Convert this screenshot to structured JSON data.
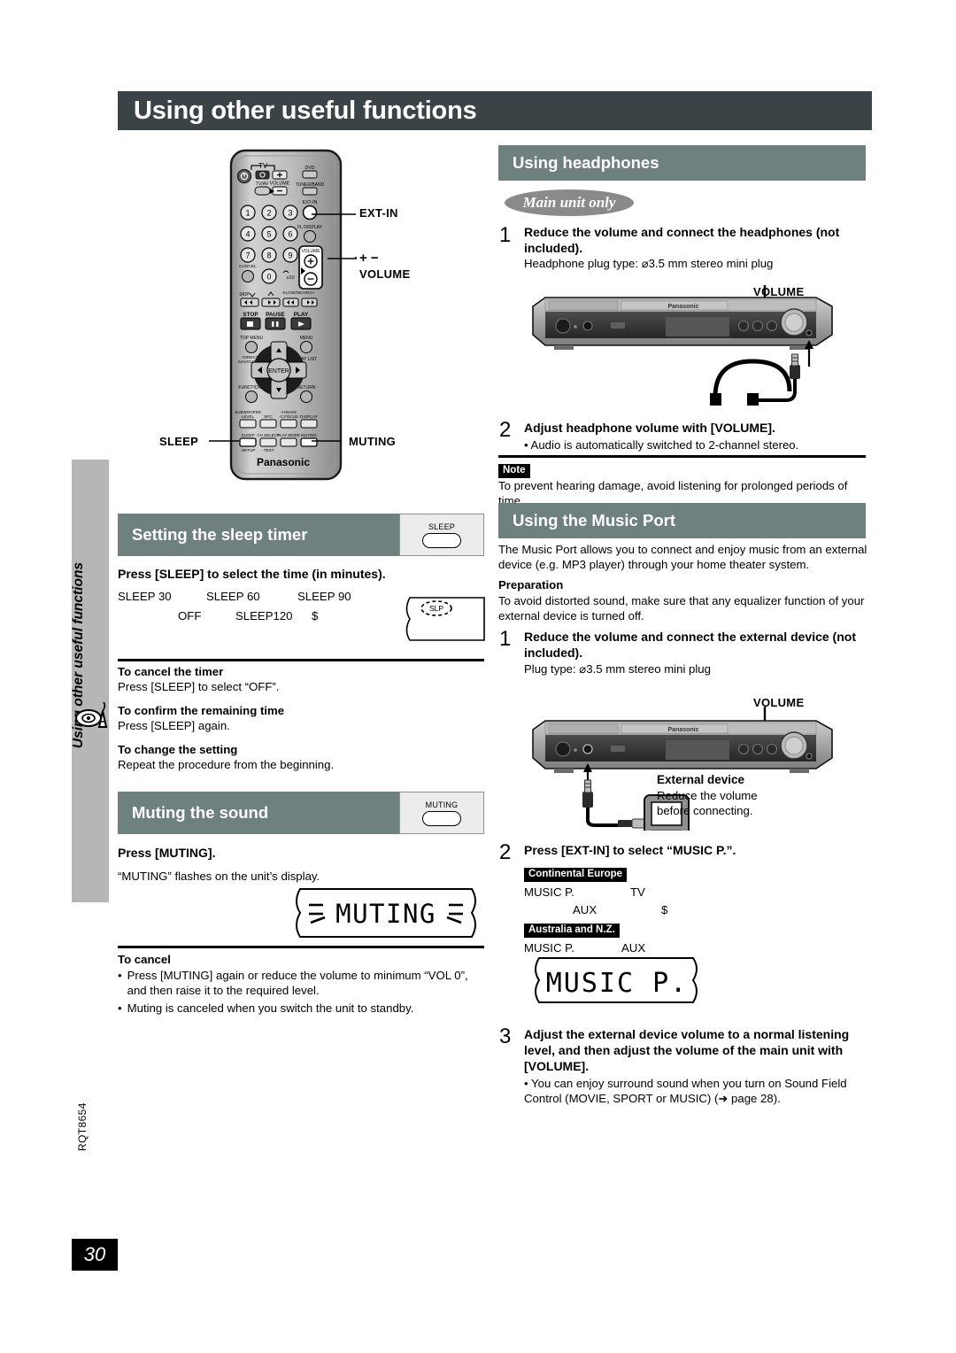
{
  "page": {
    "title": "Using other useful functions",
    "sidebar_label": "Using other useful functions",
    "sidebar_icon": "disc-antenna-icon",
    "page_number": "30",
    "doc_code": "RQT8654",
    "accent_header": "#6e817e",
    "title_bar_color": "#3b4346"
  },
  "remote": {
    "brand": "Panasonic",
    "tv_group_label": "TV",
    "volume_label": "VOLUME",
    "tv_av_label": "TV/AV",
    "source_buttons": [
      "DVD",
      "TUNER/BAND",
      "EXT-IN",
      "FL DISPLAY"
    ],
    "numbers": [
      "1",
      "2",
      "3",
      "4",
      "5",
      "6",
      "7",
      "8",
      "9",
      "0"
    ],
    "cancel_label": "CANCEL",
    "ten_label": "≥10",
    "skip_label": "SKIP",
    "slow_search_label": "SLOW/SEARCH",
    "transport": [
      "STOP",
      "PAUSE",
      "PLAY"
    ],
    "menu_buttons": [
      "TOP MENU",
      "MENU",
      "DIRECT NAVIGATOR",
      "PLAY LIST",
      "FUNCTIONS",
      "RETURN"
    ],
    "enter_label": "ENTER",
    "fn_row1": [
      "SUBWOOFER LEVEL",
      "SFC",
      "H.BASS C.FOCUS",
      "DISPLAY"
    ],
    "fn_row2": [
      "SLEEP",
      "CH SELECT",
      "PLAY MODE",
      "MUTING"
    ],
    "fn_row2_sub": [
      "-SETUP",
      "-TEST"
    ],
    "callouts": {
      "ext_in": "EXT-IN",
      "volume_plus_minus": "+  −",
      "volume": "VOLUME",
      "sleep": "SLEEP",
      "muting": "MUTING"
    }
  },
  "sleep_timer": {
    "heading": "Setting the sleep timer",
    "button_label": "SLEEP",
    "instruction": "Press [SLEEP] to select the time (in minutes).",
    "sequence_row1": [
      "SLEEP 30",
      "SLEEP 60",
      "SLEEP 90"
    ],
    "sequence_row2": [
      "OFF",
      "SLEEP120",
      "$"
    ],
    "display_indicator": "SLP",
    "notes": [
      {
        "title": "To cancel the timer",
        "body": "Press [SLEEP] to select “OFF”."
      },
      {
        "title": "To confirm the remaining time",
        "body": "Press [SLEEP] again."
      },
      {
        "title": "To change the setting",
        "body": "Repeat the procedure from the beginning."
      }
    ]
  },
  "muting": {
    "heading": "Muting the sound",
    "button_label": "MUTING",
    "instruction": "Press [MUTING].",
    "body": "“MUTING” flashes on the unit’s display.",
    "display_text": "MUTING",
    "cancel_title": "To cancel",
    "cancel_bullets": [
      "Press [MUTING] again or reduce the volume to minimum “VOL 0”, and then raise it to the required level.",
      "Muting is canceled when you switch the unit to standby."
    ]
  },
  "headphones": {
    "heading": "Using headphones",
    "pill": "Main unit only",
    "steps": [
      {
        "num": "1",
        "title": "Reduce the volume and connect the headphones (not included).",
        "body": "Headphone plug type:  ⌀3.5 mm stereo mini plug"
      },
      {
        "num": "2",
        "title": "Adjust headphone volume with [VOLUME].",
        "body": "• Audio is automatically switched to 2-channel stereo."
      }
    ],
    "diagram_volume_label": "VOLUME",
    "diagram_brand": "Panasonic",
    "note_badge": "Note",
    "note_text": "To prevent hearing damage, avoid listening for prolonged periods of time."
  },
  "music_port": {
    "heading": "Using the Music Port",
    "intro": "The Music Port allows you to connect and enjoy music from an external device (e.g. MP3 player) through your home theater system.",
    "preparation_title": "Preparation",
    "preparation_body": "To avoid distorted sound, make sure that any equalizer function of your external device is turned off.",
    "steps": [
      {
        "num": "1",
        "title": "Reduce the volume and connect the external device (not included).",
        "body": "Plug type:  ⌀3.5 mm stereo mini plug"
      },
      {
        "num": "2",
        "title": "Press [EXT-IN] to select “MUSIC P.”."
      },
      {
        "num": "3",
        "title": "Adjust the external device volume to a normal listening level, and then adjust the volume of the main unit with [VOLUME].",
        "body": "• You can enjoy surround sound when you turn on Sound Field Control (MOVIE, SPORT or MUSIC) (➜ page 28)."
      }
    ],
    "diagram_volume_label": "VOLUME",
    "external_device_title": "External device",
    "external_device_body_1": "Reduce the volume",
    "external_device_body_2": "before connecting.",
    "regions": [
      {
        "badge": "Continental Europe",
        "row1": [
          "MUSIC P.",
          "TV"
        ],
        "row2": [
          "AUX",
          "$"
        ]
      },
      {
        "badge": "Australia and N.Z.",
        "row1": [
          "MUSIC P.",
          "AUX"
        ]
      }
    ],
    "display_text": "MUSIC P."
  }
}
